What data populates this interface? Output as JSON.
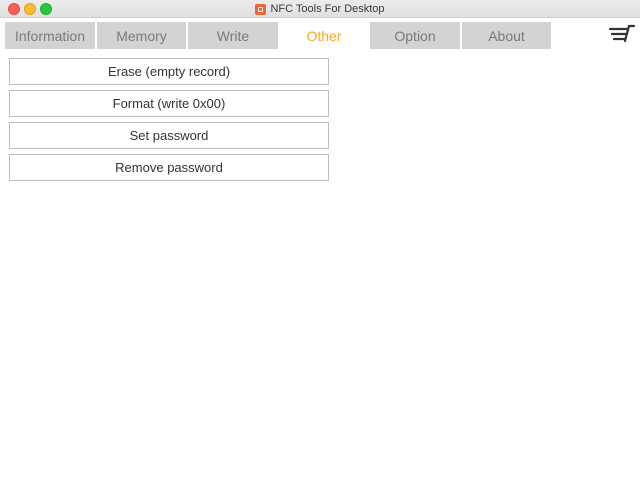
{
  "window": {
    "title": "NFC Tools For Desktop"
  },
  "tabs": [
    {
      "label": "Information"
    },
    {
      "label": "Memory"
    },
    {
      "label": "Write"
    },
    {
      "label": "Other"
    },
    {
      "label": "Option"
    },
    {
      "label": "About"
    }
  ],
  "active_tab": "Other",
  "actions": [
    {
      "label": "Erase (empty record)"
    },
    {
      "label": "Format (write 0x00)"
    },
    {
      "label": "Set password"
    },
    {
      "label": "Remove password"
    }
  ],
  "icons": {
    "app": "nfc-tools-app-icon",
    "cart": "shopping-cart-icon"
  },
  "colors": {
    "active_tab_text": "#f5a623",
    "inactive_tab_bg": "#d3d3d3",
    "inactive_tab_text": "#7a7a7a",
    "close": "#fc5f57",
    "minimize": "#fdbc2e",
    "maximize": "#28c840"
  }
}
